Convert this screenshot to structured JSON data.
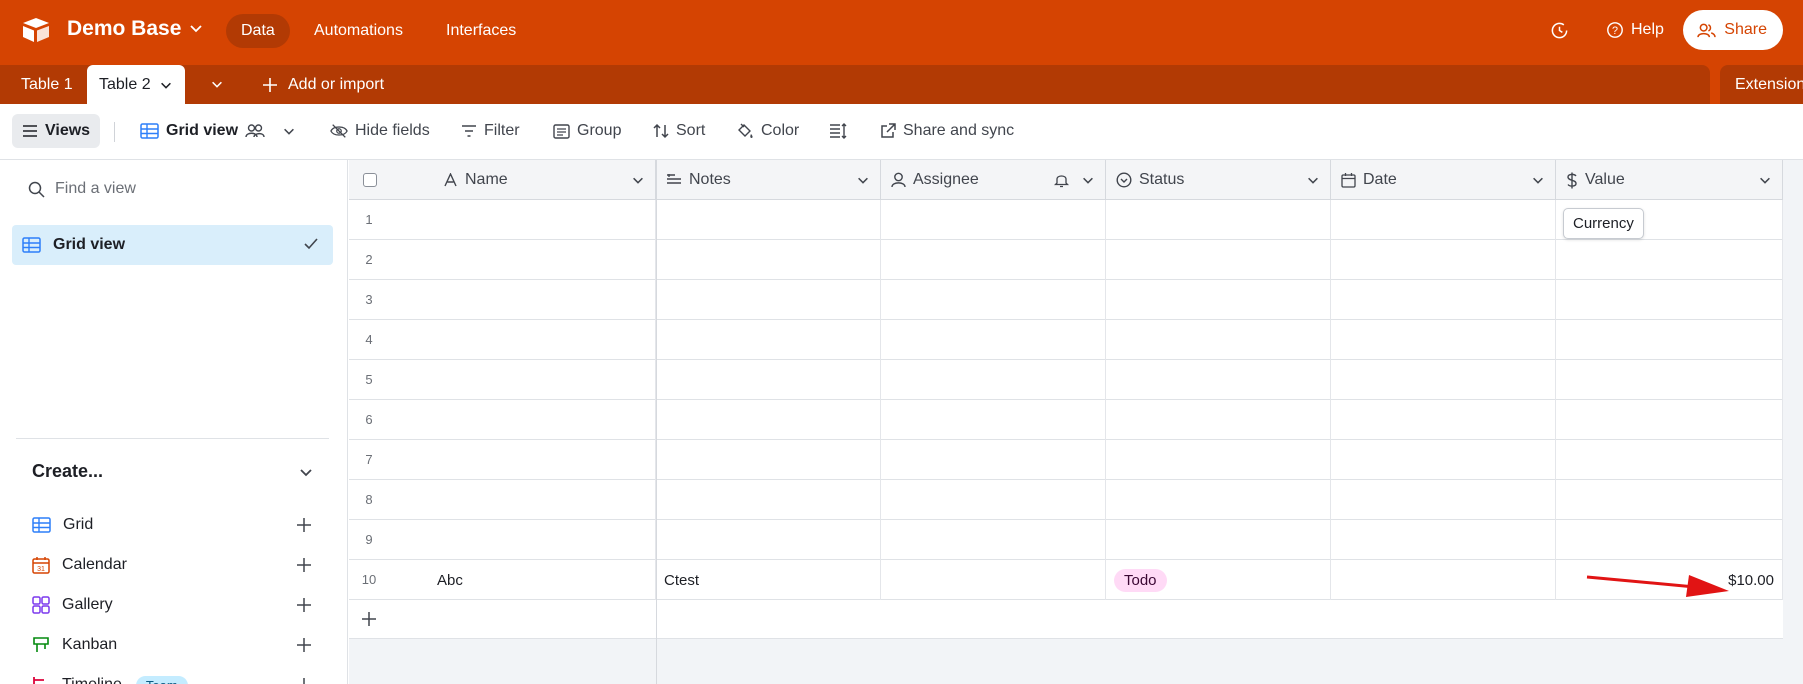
{
  "app": {
    "base_name": "Demo Base"
  },
  "nav": {
    "data": "Data",
    "automations": "Automations",
    "interfaces": "Interfaces"
  },
  "header_right": {
    "help": "Help",
    "share": "Share"
  },
  "tabs": {
    "table1": "Table 1",
    "table2": "Table 2",
    "add": "Add or import",
    "extensions": "Extensions"
  },
  "toolbar": {
    "views": "Views",
    "view_name": "Grid view",
    "hide_fields": "Hide fields",
    "filter": "Filter",
    "group": "Group",
    "sort": "Sort",
    "color": "Color",
    "share_sync": "Share and sync"
  },
  "sidebar": {
    "find_placeholder": "Find a view",
    "active_view": "Grid view",
    "create_label": "Create...",
    "create_items": [
      {
        "label": "Grid",
        "icon": "grid-icon"
      },
      {
        "label": "Calendar",
        "icon": "calendar-icon"
      },
      {
        "label": "Gallery",
        "icon": "gallery-icon"
      },
      {
        "label": "Kanban",
        "icon": "kanban-icon"
      },
      {
        "label": "Timeline",
        "icon": "timeline-icon",
        "badge": "Team"
      }
    ]
  },
  "grid": {
    "columns": [
      {
        "label": "Name",
        "icon": "text-icon"
      },
      {
        "label": "Notes",
        "icon": "long-text-icon"
      },
      {
        "label": "Assignee",
        "icon": "user-icon"
      },
      {
        "label": "Status",
        "icon": "status-icon"
      },
      {
        "label": "Date",
        "icon": "date-icon"
      },
      {
        "label": "Value",
        "icon": "currency-icon"
      }
    ],
    "row_numbers": [
      "1",
      "2",
      "3",
      "4",
      "5",
      "6",
      "7",
      "8",
      "9",
      "10"
    ],
    "row10": {
      "name": "Abc",
      "notes": "Ctest",
      "status": "Todo",
      "value": "$10.00"
    },
    "tooltip": "Currency"
  },
  "colors": {
    "brand": "#d54402",
    "brand_dark": "#b23a04",
    "selection": "#d9eefb",
    "status_tag": "#ffdaf6"
  }
}
